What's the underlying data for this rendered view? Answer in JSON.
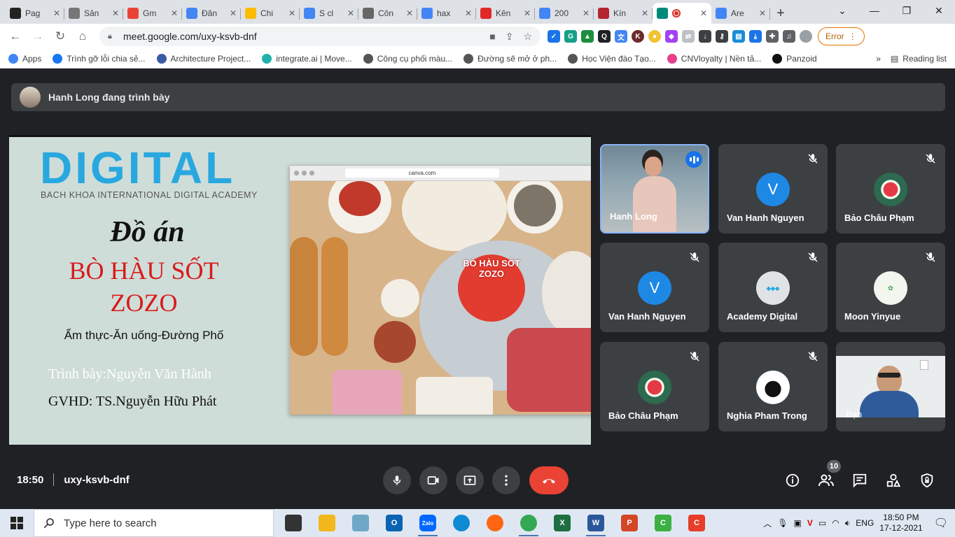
{
  "browser": {
    "tabs": [
      {
        "label": "Pag",
        "icon": "notion-icon",
        "color": "#222222"
      },
      {
        "label": "Sản",
        "icon": "mercedes-icon",
        "color": "#777777"
      },
      {
        "label": "Gm",
        "icon": "gmail-icon",
        "color": "#ea4335"
      },
      {
        "label": "Đăn",
        "icon": "google-icon",
        "color": "#4285f4"
      },
      {
        "label": "Chi",
        "icon": "google-ads-icon",
        "color": "#fbbc04"
      },
      {
        "label": "S cl",
        "icon": "google-icon",
        "color": "#4285f4"
      },
      {
        "label": "Côn",
        "icon": "globe-icon",
        "color": "#666666"
      },
      {
        "label": "hax",
        "icon": "google-icon",
        "color": "#4285f4"
      },
      {
        "label": "Kên",
        "icon": "flipboard-icon",
        "color": "#e12828"
      },
      {
        "label": "200",
        "icon": "google-icon",
        "color": "#4285f4"
      },
      {
        "label": "Kín",
        "icon": "book-icon",
        "color": "#b3262f"
      },
      {
        "label": "",
        "icon": "google-meet-icon",
        "color": "#00897b",
        "active": true
      },
      {
        "label": "Are",
        "icon": "google-icon",
        "color": "#4285f4"
      }
    ],
    "url": "meet.google.com/uxy-ksvb-dnf",
    "error_label": "Error",
    "bookmarks": [
      {
        "label": "Apps",
        "color": "#4285f4"
      },
      {
        "label": "Trình gỡ lỗi chia sẻ...",
        "color": "#1877f2"
      },
      {
        "label": "Architecture Project...",
        "color": "#3b5ba5"
      },
      {
        "label": "integrate.ai | Move...",
        "color": "#20b2aa"
      },
      {
        "label": "Công cụ phối màu...",
        "color": "#555555"
      },
      {
        "label": "Đường sẽ mở ở ph...",
        "color": "#555555"
      },
      {
        "label": "Học Viện đào Tạo...",
        "color": "#555555"
      },
      {
        "label": "CNVloyalty | Nền tả...",
        "color": "#e83e8c"
      },
      {
        "label": "Panzoid",
        "color": "#111111"
      }
    ],
    "more_label": "»",
    "reading_list_label": "Reading list"
  },
  "meet": {
    "presenting_text": "Hanh Long đang trình bày",
    "slide": {
      "logo": "DIGITAL",
      "logo_sub": "BACH KHOA INTERNATIONAL DIGITAL ACADEMY",
      "title_line1": "Đồ án",
      "title_line2": "BÒ HÀU SỐT",
      "title_line3": "ZOZO",
      "category": "Ẩm thực-Ăn uống-Đường Phố",
      "presenter": "Trình bày:Nguyễn Văn Hành",
      "advisor": "GVHD: TS.Nguyễn Hữu Phát",
      "mock_url": "canva.com",
      "pan_text": "BÒ HÀU SỐT ZOZO"
    },
    "participants": [
      {
        "name": "Hanh Long",
        "type": "video",
        "speaking": true
      },
      {
        "name": "Van Hanh Nguyen",
        "type": "letter",
        "initial": "V",
        "color": "#1e88e5",
        "muted": true
      },
      {
        "name": "Bảo Châu Phạm",
        "type": "flower",
        "muted": true
      },
      {
        "name": "Van Hanh Nguyen",
        "type": "letter",
        "initial": "V",
        "color": "#1e88e5",
        "muted": true
      },
      {
        "name": "Academy Digital",
        "type": "logo",
        "muted": true
      },
      {
        "name": "Moon Yinyue",
        "type": "moon",
        "muted": true
      },
      {
        "name": "Bảo Châu Phạm",
        "type": "flower",
        "muted": true
      },
      {
        "name": "Nghia Pham Trong",
        "type": "dog",
        "muted": true
      },
      {
        "name": "Bạn",
        "type": "self-video"
      }
    ],
    "time": "18:50",
    "meeting_code": "uxy-ksvb-dnf",
    "participant_count": "10"
  },
  "taskbar": {
    "search_placeholder": "Type here to search",
    "apps": [
      {
        "icon": "task-view-icon",
        "color": "#333333",
        "open": false
      },
      {
        "icon": "file-explorer-icon",
        "color": "#f2b71b",
        "open": false
      },
      {
        "icon": "notepad-icon",
        "color": "#6fa8c7",
        "open": false
      },
      {
        "icon": "outlook-icon",
        "color": "#0a64b4",
        "open": false,
        "text": "O"
      },
      {
        "icon": "zalo-icon",
        "color": "#0068ff",
        "open": true,
        "text": "Zalo"
      },
      {
        "icon": "edge-icon",
        "color": "#0f8ad4",
        "open": false
      },
      {
        "icon": "firefox-icon",
        "color": "#ff6611",
        "open": false
      },
      {
        "icon": "chrome-icon",
        "color": "#34a853",
        "open": true
      },
      {
        "icon": "excel-icon",
        "color": "#1d6f42",
        "open": false,
        "text": "X"
      },
      {
        "icon": "word-icon",
        "color": "#2b579a",
        "open": true,
        "text": "W"
      },
      {
        "icon": "powerpoint-icon",
        "color": "#d24726",
        "open": false,
        "text": "P"
      },
      {
        "icon": "camtasia-green-icon",
        "color": "#3cb043",
        "open": false,
        "text": "C"
      },
      {
        "icon": "camtasia-red-icon",
        "color": "#e63e2b",
        "open": false,
        "text": "C"
      }
    ],
    "language": "ENG",
    "time": "18:50 PM",
    "date": "17-12-2021"
  }
}
